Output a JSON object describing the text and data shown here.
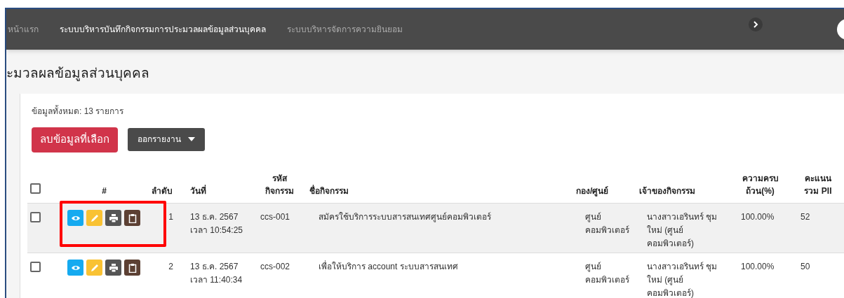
{
  "nav": {
    "items": [
      {
        "label": "หน้าแรก",
        "selected": false
      },
      {
        "label": "ระบบบริหารบันทึกกิจกรรมการประมวลผลข้อมูลส่วนบุคคล",
        "selected": true
      },
      {
        "label": "ระบบบริหารจัดการความยินยอม",
        "selected": false
      }
    ]
  },
  "page_title": "ะมวลผลข้อมูลส่วนบุคคล",
  "total": "ข้อมูลทั้งหมด: 13 รายการ",
  "buttons": [
    {
      "kind": "danger",
      "label": "ลบข้อมูลที่เลือก"
    },
    {
      "kind": "dropdown",
      "label": "ออกรายงาน"
    }
  ],
  "table": {
    "select_all": {
      "checked": false
    },
    "columns": [
      "#",
      "ลำดับ",
      "วันที่",
      "รหัส กิจกรรม",
      "ชื่อกิจกรรม",
      "กอง/ศูนย์",
      "เจ้าของกิจกรรม",
      "ความครบ ถ้วน(%)",
      "คะแนน รวม PII"
    ],
    "rows": [
      {
        "checked": false,
        "highlighted": true,
        "seq": "1",
        "date": "13 ธ.ค. 2567",
        "time": "เวลา 10:54:25",
        "code": "ccs-001",
        "name": "สมัครใช้บริการระบบสารสนเทศศูนย์คอมพิวเตอร์",
        "dept": "ศูนย์ คอมพิวเตอร์",
        "owner": "นางสาวเอรินทร์ ชุม ใหม่ (ศูนย์ คอมพิวเตอร์)",
        "complete": "100.00%",
        "score": "52"
      },
      {
        "checked": false,
        "highlighted": false,
        "seq": "2",
        "date": "13 ธ.ค. 2567",
        "time": "เวลา 11:40:34",
        "code": "ccs-002",
        "name": "เพื่อให้บริการ account ระบบสารสนเทศ",
        "dept": "ศูนย์ คอมพิวเตอร์",
        "owner": "นางสาวเอรินทร์ ชุม ใหม่ (ศูนย์ คอมพิวเตอร์)",
        "complete": "100.00%",
        "score": "50"
      }
    ]
  }
}
